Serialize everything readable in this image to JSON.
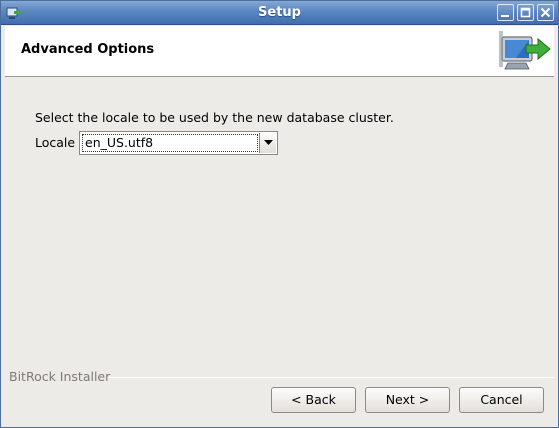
{
  "window": {
    "title": "Setup"
  },
  "header": {
    "title": "Advanced Options",
    "logo_icon": "computer-arrow-icon"
  },
  "main": {
    "prompt": "Select the locale to be used by the new database cluster.",
    "locale_label": "Locale",
    "locale_value": "en_US.utf8"
  },
  "footer": {
    "brand": "BitRock Installer",
    "back_label": "< Back",
    "next_label": "Next >",
    "cancel_label": "Cancel"
  },
  "colors": {
    "titlebar": "#5b86c2",
    "background": "#edebe7",
    "header_bg": "#ffffff",
    "brand_text": "#7e7b76"
  }
}
